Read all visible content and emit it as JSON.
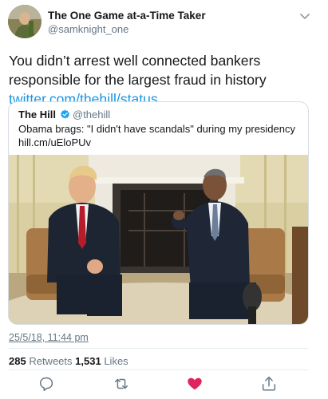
{
  "author": {
    "display_name": "The One Game at-a-Time Taker",
    "handle": "@samknight_one"
  },
  "tweet": {
    "text": "You didn’t arrest well connected bankers responsible for the largest fraud in history ",
    "link": "twitter.com/thehill/status..."
  },
  "quoted": {
    "name": "The Hill",
    "verified": true,
    "handle": "@thehill",
    "text": "Obama brags: \"I didn't have scandals\" during my presidency hill.cm/uEloPUv"
  },
  "timestamp": "25/5/18, 11:44 pm",
  "stats": {
    "retweets_count": "285",
    "retweets_label": "Retweets",
    "likes_count": "1,531",
    "likes_label": "Likes"
  },
  "colors": {
    "link": "#1b95e0",
    "secondary_text": "#657786",
    "like_active": "#e0245e"
  },
  "icons": {
    "actions": [
      "reply-icon",
      "retweet-icon",
      "like-icon",
      "share-icon"
    ],
    "like_active": true
  }
}
